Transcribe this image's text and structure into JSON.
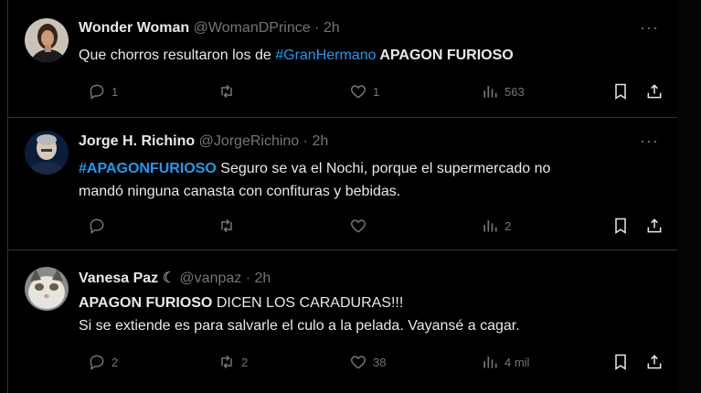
{
  "tweets": [
    {
      "name": "Wonder Woman",
      "handle": "@WomanDPrince",
      "dot": "·",
      "time": "2h",
      "text_plain": "Que chorros resultaron los de ",
      "text_tag": "#GranHermano",
      "text_bold": " APAGON FURIOSO",
      "replies": "1",
      "retweets": "",
      "likes": "1",
      "views": "563"
    },
    {
      "name": "Jorge H. Richino",
      "handle": "@JorgeRichino",
      "dot": "·",
      "time": "2h",
      "text_tag": "#APAGONFURIOSO",
      "text_line1": " Seguro se va el Nochi, porque el supermercado no",
      "text_line2": "mandó ninguna canasta con confituras y bebidas.",
      "replies": "",
      "retweets": "",
      "likes": "",
      "views": "2"
    },
    {
      "name": "Vanesa Paz",
      "name_badge": "☾",
      "handle": "@vanpaz",
      "dot": "·",
      "time": "2h",
      "text_bold": "APAGON FURIOSO",
      "text_rest": " DICEN LOS CARADURAS!!!",
      "text_line2": "Si se extiende es para salvarle el culo a la pelada. Vayansé a cagar.",
      "replies": "2",
      "retweets": "2",
      "likes": "38",
      "views": "4 mil"
    }
  ],
  "icons": {
    "more": "more-dots-icon",
    "reply": "reply-icon",
    "retweet": "retweet-icon",
    "like": "like-icon",
    "views": "views-icon",
    "bookmark": "bookmark-icon",
    "share": "share-icon"
  },
  "colors": {
    "background": "#000000",
    "text": "#e7e9ea",
    "muted": "#71767b",
    "link": "#1d9bf0",
    "divider": "#2f3336"
  }
}
